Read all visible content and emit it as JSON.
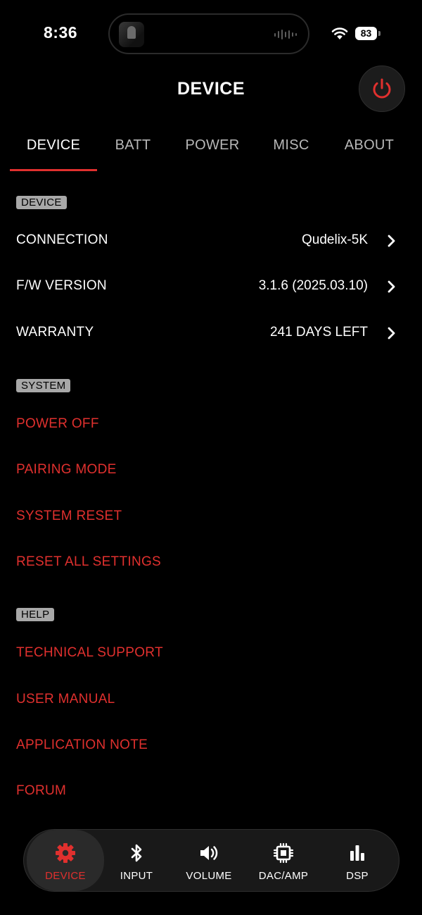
{
  "status_bar": {
    "time": "8:36",
    "battery": "83"
  },
  "header": {
    "title": "DEVICE",
    "power_icon": "power-icon"
  },
  "tabs": [
    {
      "label": "DEVICE",
      "active": true
    },
    {
      "label": "BATT",
      "active": false
    },
    {
      "label": "POWER",
      "active": false
    },
    {
      "label": "MISC",
      "active": false
    },
    {
      "label": "ABOUT",
      "active": false
    }
  ],
  "sections": {
    "device": {
      "badge": "DEVICE",
      "rows": [
        {
          "label": "CONNECTION",
          "value": "Qudelix-5K"
        },
        {
          "label": "F/W VERSION",
          "value": "3.1.6 (2025.03.10)"
        },
        {
          "label": "WARRANTY",
          "value": "241 DAYS LEFT"
        }
      ]
    },
    "system": {
      "badge": "SYSTEM",
      "items": [
        "POWER OFF",
        "PAIRING MODE",
        "SYSTEM RESET",
        "RESET ALL SETTINGS"
      ]
    },
    "help": {
      "badge": "HELP",
      "items": [
        "TECHNICAL SUPPORT",
        "USER MANUAL",
        "APPLICATION NOTE",
        "FORUM"
      ]
    }
  },
  "bottom_nav": [
    {
      "label": "DEVICE",
      "icon": "gear-icon",
      "active": true
    },
    {
      "label": "INPUT",
      "icon": "bluetooth-icon",
      "active": false
    },
    {
      "label": "VOLUME",
      "icon": "speaker-icon",
      "active": false
    },
    {
      "label": "DAC/AMP",
      "icon": "chip-icon",
      "active": false
    },
    {
      "label": "DSP",
      "icon": "bar-chart-icon",
      "active": false
    }
  ],
  "colors": {
    "accent": "#e0302e",
    "background": "#000000",
    "badge": "#a8a8a8"
  }
}
